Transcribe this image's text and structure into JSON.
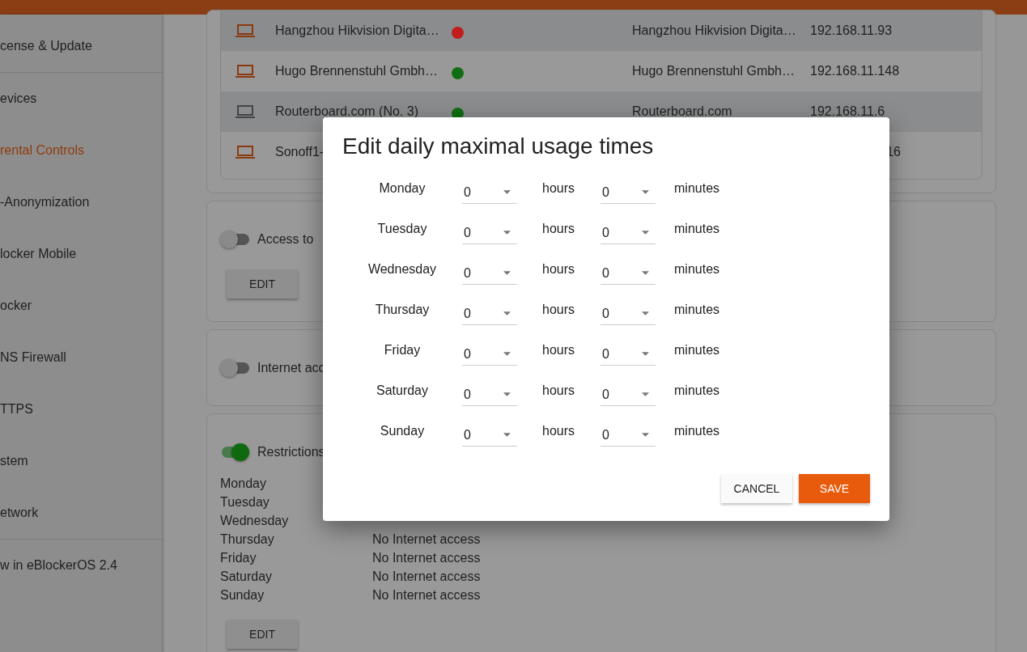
{
  "sidebar": {
    "groups": [
      [
        {
          "label": "cense & Update",
          "selected": false
        }
      ],
      [
        {
          "label": "evices",
          "selected": false
        },
        {
          "label": "rental Controls",
          "selected": true
        },
        {
          "label": "-Anonymization",
          "selected": false
        },
        {
          "label": "locker Mobile",
          "selected": false
        },
        {
          "label": "ocker",
          "selected": false
        },
        {
          "label": "NS Firewall",
          "selected": false
        },
        {
          "label": "TTPS",
          "selected": false
        },
        {
          "label": "stem",
          "selected": false
        },
        {
          "label": "etwork",
          "selected": false
        }
      ],
      [
        {
          "label": "w in eBlockerOS 2.4",
          "selected": false
        }
      ]
    ]
  },
  "devices": [
    {
      "name": "Hangzhou Hikvision Digita…",
      "active": true,
      "color": "#c21d1d",
      "vendor": "Hangzhou Hikvision Digita…",
      "ip": "192.168.11.93",
      "cut": false
    },
    {
      "name": "Hugo Brennenstuhl Gmbh…",
      "active": true,
      "color": "#116d11",
      "vendor": "Hugo Brennenstuhl Gmbh…",
      "ip": "192.168.11.148",
      "cut": false
    },
    {
      "name": "Routerboard.com (No. 3)",
      "active": false,
      "color": "#116d11",
      "vendor": "Routerboard.com",
      "ip": "192.168.11.6",
      "cut": false
    },
    {
      "name": "Sonoff1-",
      "active": true,
      "ip": "16",
      "cut": true
    }
  ],
  "cards": [
    {
      "label": "Access to",
      "on": false,
      "button": "EDIT"
    },
    {
      "label": "Internet acc",
      "on": false
    },
    {
      "label": "Restrictions",
      "on": true,
      "days": [
        {
          "day": "Monday"
        },
        {
          "day": "Tuesday"
        },
        {
          "day": "Wednesday"
        },
        {
          "day": "Thursday",
          "value": "No Internet access"
        },
        {
          "day": "Friday",
          "value": "No Internet access"
        },
        {
          "day": "Saturday",
          "value": "No Internet access"
        },
        {
          "day": "Sunday",
          "value": "No Internet access"
        }
      ],
      "button": "EDIT"
    }
  ],
  "dialog": {
    "title": "Edit daily maximal usage times",
    "rows": [
      {
        "day": "Monday",
        "hours": "0",
        "hours_label": "hours",
        "minutes": "0",
        "minutes_label": "minutes"
      },
      {
        "day": "Tuesday",
        "hours": "0",
        "hours_label": "hours",
        "minutes": "0",
        "minutes_label": "minutes"
      },
      {
        "day": "Wednesday",
        "hours": "0",
        "hours_label": "hours",
        "minutes": "0",
        "minutes_label": "minutes"
      },
      {
        "day": "Thursday",
        "hours": "0",
        "hours_label": "hours",
        "minutes": "0",
        "minutes_label": "minutes"
      },
      {
        "day": "Friday",
        "hours": "0",
        "hours_label": "hours",
        "minutes": "0",
        "minutes_label": "minutes"
      },
      {
        "day": "Saturday",
        "hours": "0",
        "hours_label": "hours",
        "minutes": "0",
        "minutes_label": "minutes"
      },
      {
        "day": "Sunday",
        "hours": "0",
        "hours_label": "hours",
        "minutes": "0",
        "minutes_label": "minutes"
      }
    ],
    "buttons": [
      "CANCEL",
      "SAVE"
    ]
  }
}
